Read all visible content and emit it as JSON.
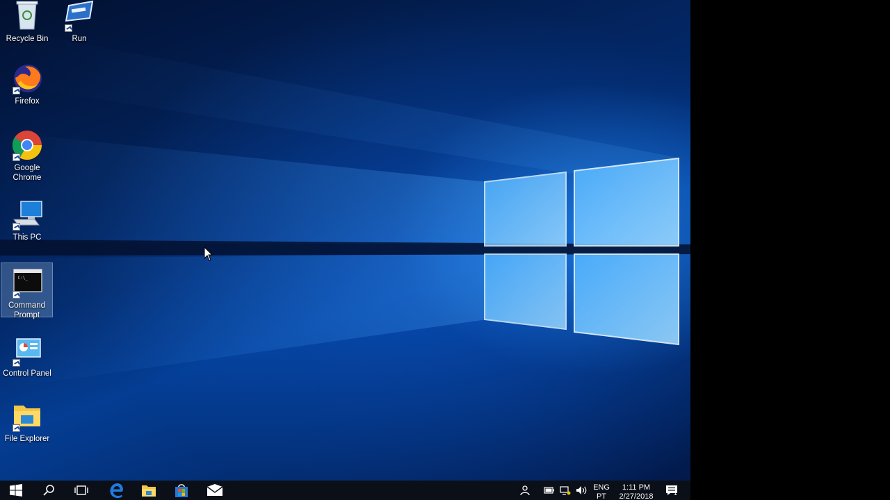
{
  "desktop": {
    "icons": [
      {
        "label": "Recycle Bin",
        "icon": "recycle-bin-icon"
      },
      {
        "label": "Run",
        "icon": "run-icon"
      },
      {
        "label": "Firefox",
        "icon": "firefox-icon"
      },
      {
        "label": "Google Chrome",
        "icon": "chrome-icon"
      },
      {
        "label": "This PC",
        "icon": "this-pc-icon"
      },
      {
        "label": "Command Prompt",
        "icon": "command-prompt-icon",
        "selected": true
      },
      {
        "label": "Control Panel",
        "icon": "control-panel-icon"
      },
      {
        "label": "File Explorer",
        "icon": "file-explorer-icon"
      }
    ],
    "cmd_preview": "C:\\_"
  },
  "taskbar": {
    "pinned": [
      "start-icon",
      "search-icon",
      "task-view-icon",
      "edge-icon",
      "file-explorer-icon",
      "store-icon",
      "mail-icon"
    ],
    "tray": {
      "language": "ENG",
      "language_sub": "PT",
      "time": "1:11 PM",
      "date": "2/27/2018",
      "notification_count": "1"
    }
  },
  "colors": {
    "wallpaper_accent": "#2f9bff",
    "taskbar_bg": "#0b0f17",
    "selection": "#aac8e6"
  }
}
